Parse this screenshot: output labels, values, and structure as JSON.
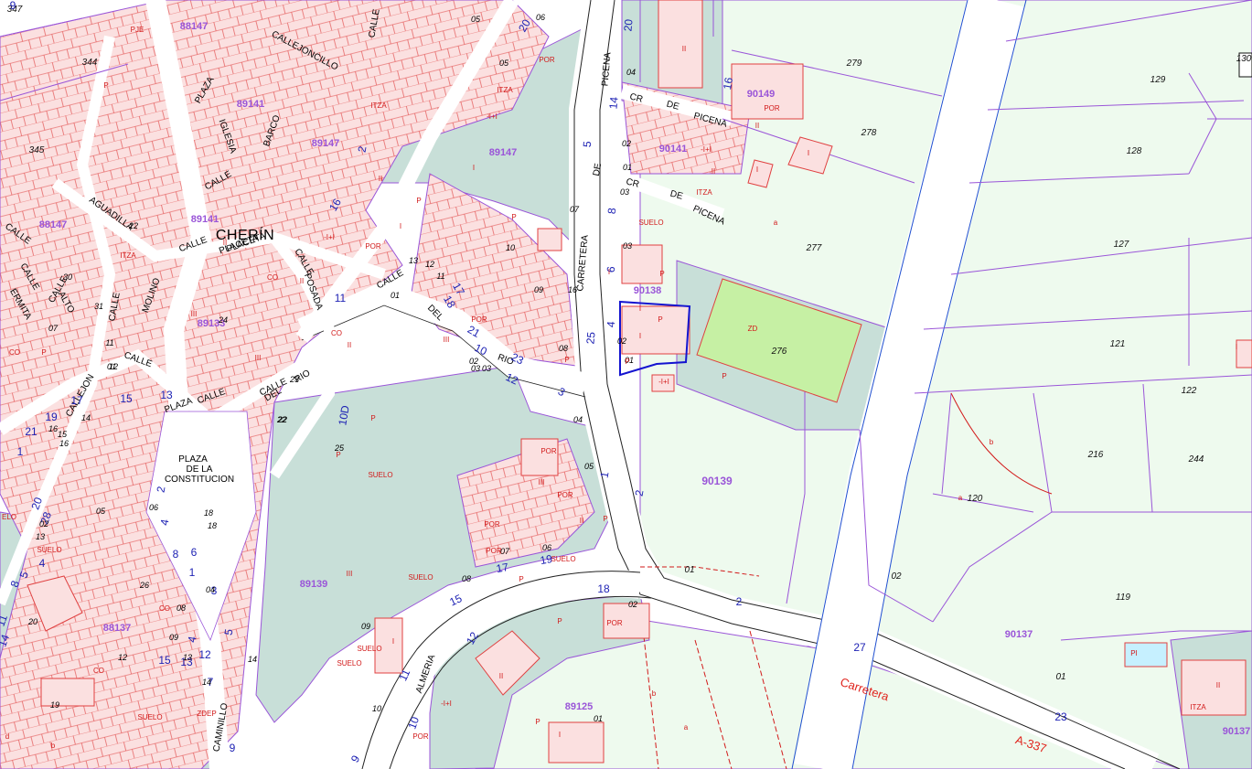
{
  "map": {
    "town": "CHERÍN",
    "colors": {
      "background": "#ffffff",
      "parcel_fill": "#eefaee",
      "built_block": "#c8dfd8",
      "building": "#fbe0e0",
      "building_line": "#e04040",
      "parcel_line": "#9a55d8",
      "road_line": "#222222",
      "label_blue": "#1e22b4",
      "label_red": "#d21a1a",
      "field_green": "#c6f0a4",
      "selection": "#1414d0",
      "pool": "#c6f0ff"
    },
    "streets": [
      {
        "name": "CALLE"
      },
      {
        "name": "CALLEJONCILLO"
      },
      {
        "name": "PLAZA"
      },
      {
        "name": "IGLESIA"
      },
      {
        "name": "BARCO"
      },
      {
        "name": "CALLE"
      },
      {
        "name": "PLACETA"
      },
      {
        "name": "AGUADILLA"
      },
      {
        "name": "CALLE"
      },
      {
        "name": "PLACETA"
      },
      {
        "name": "CALLE"
      },
      {
        "name": "POSADA"
      },
      {
        "name": "CALLE"
      },
      {
        "name": "MOLINO"
      },
      {
        "name": "CALLE"
      },
      {
        "name": "ERMITA"
      },
      {
        "name": "CALLE"
      },
      {
        "name": "ALTO"
      },
      {
        "name": "CALLE"
      },
      {
        "name": "CALLE"
      },
      {
        "name": "PLAZA"
      },
      {
        "name": "CALLE"
      },
      {
        "name": "DEL"
      },
      {
        "name": "RIO"
      },
      {
        "name": "CALLE"
      },
      {
        "name": "DEL"
      },
      {
        "name": "RIO"
      },
      {
        "name": "CALLEJON"
      },
      {
        "name": "CALLE"
      },
      {
        "name": "CAMINILLO"
      },
      {
        "name": "CARRETERA"
      },
      {
        "name": "DE"
      },
      {
        "name": "PICENA"
      },
      {
        "name": "CR"
      },
      {
        "name": "DE"
      },
      {
        "name": "PICENA"
      },
      {
        "name": "CR"
      },
      {
        "name": "DE"
      },
      {
        "name": "PICENA"
      },
      {
        "name": "ALMERIA"
      },
      {
        "name": "PLAZA"
      },
      {
        "name": "DE LA"
      },
      {
        "name": "CONSTITUCION"
      }
    ],
    "road_labels": [
      {
        "text": "Carretera"
      },
      {
        "text": "A-337"
      }
    ],
    "blocks": [
      {
        "id": "88147"
      },
      {
        "id": "89141"
      },
      {
        "id": "89147"
      },
      {
        "id": "88147"
      },
      {
        "id": "89141"
      },
      {
        "id": "89147"
      },
      {
        "id": "90149"
      },
      {
        "id": "90141"
      },
      {
        "id": "90138"
      },
      {
        "id": "89133"
      },
      {
        "id": "90139"
      },
      {
        "id": "89139"
      },
      {
        "id": "88137"
      },
      {
        "id": "89125"
      },
      {
        "id": "90137"
      },
      {
        "id": "90137"
      }
    ],
    "parcels": [
      {
        "id": "347"
      },
      {
        "id": "344"
      },
      {
        "id": "345"
      },
      {
        "id": "279"
      },
      {
        "id": "278"
      },
      {
        "id": "277"
      },
      {
        "id": "276"
      },
      {
        "id": "129"
      },
      {
        "id": "128"
      },
      {
        "id": "127"
      },
      {
        "id": "121"
      },
      {
        "id": "122"
      },
      {
        "id": "216"
      },
      {
        "id": "244"
      },
      {
        "id": "120"
      },
      {
        "id": "119"
      },
      {
        "id": "130"
      },
      {
        "id": "01"
      },
      {
        "id": "02"
      },
      {
        "id": "01"
      }
    ],
    "portal_numbers": [
      {
        "n": "20"
      },
      {
        "n": "14"
      },
      {
        "n": "5"
      },
      {
        "n": "8"
      },
      {
        "n": "6"
      },
      {
        "n": "4"
      },
      {
        "n": "25"
      },
      {
        "n": "2"
      },
      {
        "n": "1"
      },
      {
        "n": "27"
      },
      {
        "n": "23"
      },
      {
        "n": "18"
      },
      {
        "n": "15"
      },
      {
        "n": "12"
      },
      {
        "n": "11"
      },
      {
        "n": "10"
      },
      {
        "n": "17"
      },
      {
        "n": "19"
      },
      {
        "n": "12"
      },
      {
        "n": "10"
      },
      {
        "n": "21"
      },
      {
        "n": "23"
      },
      {
        "n": "16"
      },
      {
        "n": "17"
      },
      {
        "n": "18"
      },
      {
        "n": "20"
      },
      {
        "n": "3"
      },
      {
        "n": "2"
      },
      {
        "n": "16"
      },
      {
        "n": "11"
      },
      {
        "n": "9"
      },
      {
        "n": "7"
      },
      {
        "n": "12"
      },
      {
        "n": "10D"
      },
      {
        "n": "9"
      },
      {
        "n": "2"
      },
      {
        "n": "4"
      },
      {
        "n": "6"
      },
      {
        "n": "8"
      },
      {
        "n": "13"
      },
      {
        "n": "15"
      },
      {
        "n": "5"
      },
      {
        "n": "3"
      },
      {
        "n": "1"
      },
      {
        "n": "9"
      },
      {
        "n": "20"
      },
      {
        "n": "28"
      },
      {
        "n": "4"
      },
      {
        "n": "2"
      },
      {
        "n": "13"
      },
      {
        "n": "15"
      },
      {
        "n": "17"
      },
      {
        "n": "19"
      },
      {
        "n": "21"
      },
      {
        "n": "1"
      },
      {
        "n": "4"
      },
      {
        "n": "5"
      },
      {
        "n": "8"
      },
      {
        "n": "11"
      },
      {
        "n": "14"
      }
    ],
    "subparcels": [
      {
        "t": "04"
      },
      {
        "t": "05"
      },
      {
        "t": "06"
      },
      {
        "t": "07"
      },
      {
        "t": "10"
      },
      {
        "t": "11"
      },
      {
        "t": "12"
      },
      {
        "t": "13"
      },
      {
        "t": "01"
      },
      {
        "t": "02"
      },
      {
        "t": "03"
      },
      {
        "t": "09"
      },
      {
        "t": "08"
      },
      {
        "t": "16"
      },
      {
        "t": "05"
      },
      {
        "t": "07"
      },
      {
        "t": "06"
      },
      {
        "t": "08"
      },
      {
        "t": "04"
      },
      {
        "t": "05"
      },
      {
        "t": "02"
      },
      {
        "t": "03"
      },
      {
        "t": "01"
      },
      {
        "t": "02"
      },
      {
        "t": "01"
      },
      {
        "t": "03"
      },
      {
        "t": "02"
      },
      {
        "t": "01"
      },
      {
        "t": "04"
      },
      {
        "t": "09"
      },
      {
        "t": "10"
      },
      {
        "t": "14"
      },
      {
        "t": "19"
      },
      {
        "t": "26"
      },
      {
        "t": "08"
      },
      {
        "t": "09"
      },
      {
        "t": "12"
      },
      {
        "t": "13"
      },
      {
        "t": "14"
      },
      {
        "t": "18"
      },
      {
        "t": "22"
      },
      {
        "t": "25"
      },
      {
        "t": "06"
      },
      {
        "t": "05"
      },
      {
        "t": "24"
      },
      {
        "t": "23"
      },
      {
        "t": "22"
      },
      {
        "t": "30"
      },
      {
        "t": "31"
      },
      {
        "t": "07"
      },
      {
        "t": "15"
      },
      {
        "t": "16"
      },
      {
        "t": "20"
      },
      {
        "t": "22"
      },
      {
        "t": "01"
      },
      {
        "t": "02"
      },
      {
        "t": "14"
      },
      {
        "t": "16"
      },
      {
        "t": "11"
      },
      {
        "t": "12"
      },
      {
        "t": "13"
      },
      {
        "t": "18"
      },
      {
        "t": "03"
      }
    ],
    "codes": [
      {
        "t": "SUELO"
      },
      {
        "t": "SUELO"
      },
      {
        "t": "SUELO"
      },
      {
        "t": "SUELO"
      },
      {
        "t": "SUELO"
      },
      {
        "t": "SUELO"
      },
      {
        "t": "SUELO"
      },
      {
        "t": "SUELO"
      },
      {
        "t": "ZD"
      },
      {
        "t": "POR"
      },
      {
        "t": "POR"
      },
      {
        "t": "POR"
      },
      {
        "t": "POR"
      },
      {
        "t": "POR"
      },
      {
        "t": "POR"
      },
      {
        "t": "POR"
      },
      {
        "t": "POR"
      },
      {
        "t": "POR"
      },
      {
        "t": "POR"
      },
      {
        "t": "PI"
      },
      {
        "t": "CO"
      },
      {
        "t": "CO"
      },
      {
        "t": "CO"
      },
      {
        "t": "CO"
      },
      {
        "t": "CO"
      },
      {
        "t": "ITZA"
      },
      {
        "t": "ITZA"
      },
      {
        "t": "ITZA"
      },
      {
        "t": "ITZA"
      },
      {
        "t": "ITZA"
      },
      {
        "t": "-I+I"
      },
      {
        "t": "-I+I"
      },
      {
        "t": "-I+I"
      },
      {
        "t": "-I+I"
      },
      {
        "t": "-I+I"
      },
      {
        "t": "II"
      },
      {
        "t": "II"
      },
      {
        "t": "II"
      },
      {
        "t": "II"
      },
      {
        "t": "II"
      },
      {
        "t": "II"
      },
      {
        "t": "II"
      },
      {
        "t": "II"
      },
      {
        "t": "II"
      },
      {
        "t": "II"
      },
      {
        "t": "III"
      },
      {
        "t": "III"
      },
      {
        "t": "III"
      },
      {
        "t": "III"
      },
      {
        "t": "III"
      },
      {
        "t": "I"
      },
      {
        "t": "I"
      },
      {
        "t": "I"
      },
      {
        "t": "I"
      },
      {
        "t": "I"
      },
      {
        "t": "I"
      },
      {
        "t": "I"
      },
      {
        "t": "I"
      },
      {
        "t": "I"
      },
      {
        "t": "I"
      },
      {
        "t": "P"
      },
      {
        "t": "P"
      },
      {
        "t": "P"
      },
      {
        "t": "P"
      },
      {
        "t": "P"
      },
      {
        "t": "P"
      },
      {
        "t": "P"
      },
      {
        "t": "P"
      },
      {
        "t": "P"
      },
      {
        "t": "P"
      },
      {
        "t": "P"
      },
      {
        "t": "P"
      },
      {
        "t": "P"
      },
      {
        "t": "P"
      },
      {
        "t": "P"
      },
      {
        "t": "a"
      },
      {
        "t": "a"
      },
      {
        "t": "a"
      },
      {
        "t": "b"
      },
      {
        "t": "b"
      },
      {
        "t": "b"
      },
      {
        "t": "d"
      },
      {
        "t": "ELO"
      },
      {
        "t": "PJE"
      },
      {
        "t": "ZDEP"
      }
    ]
  }
}
